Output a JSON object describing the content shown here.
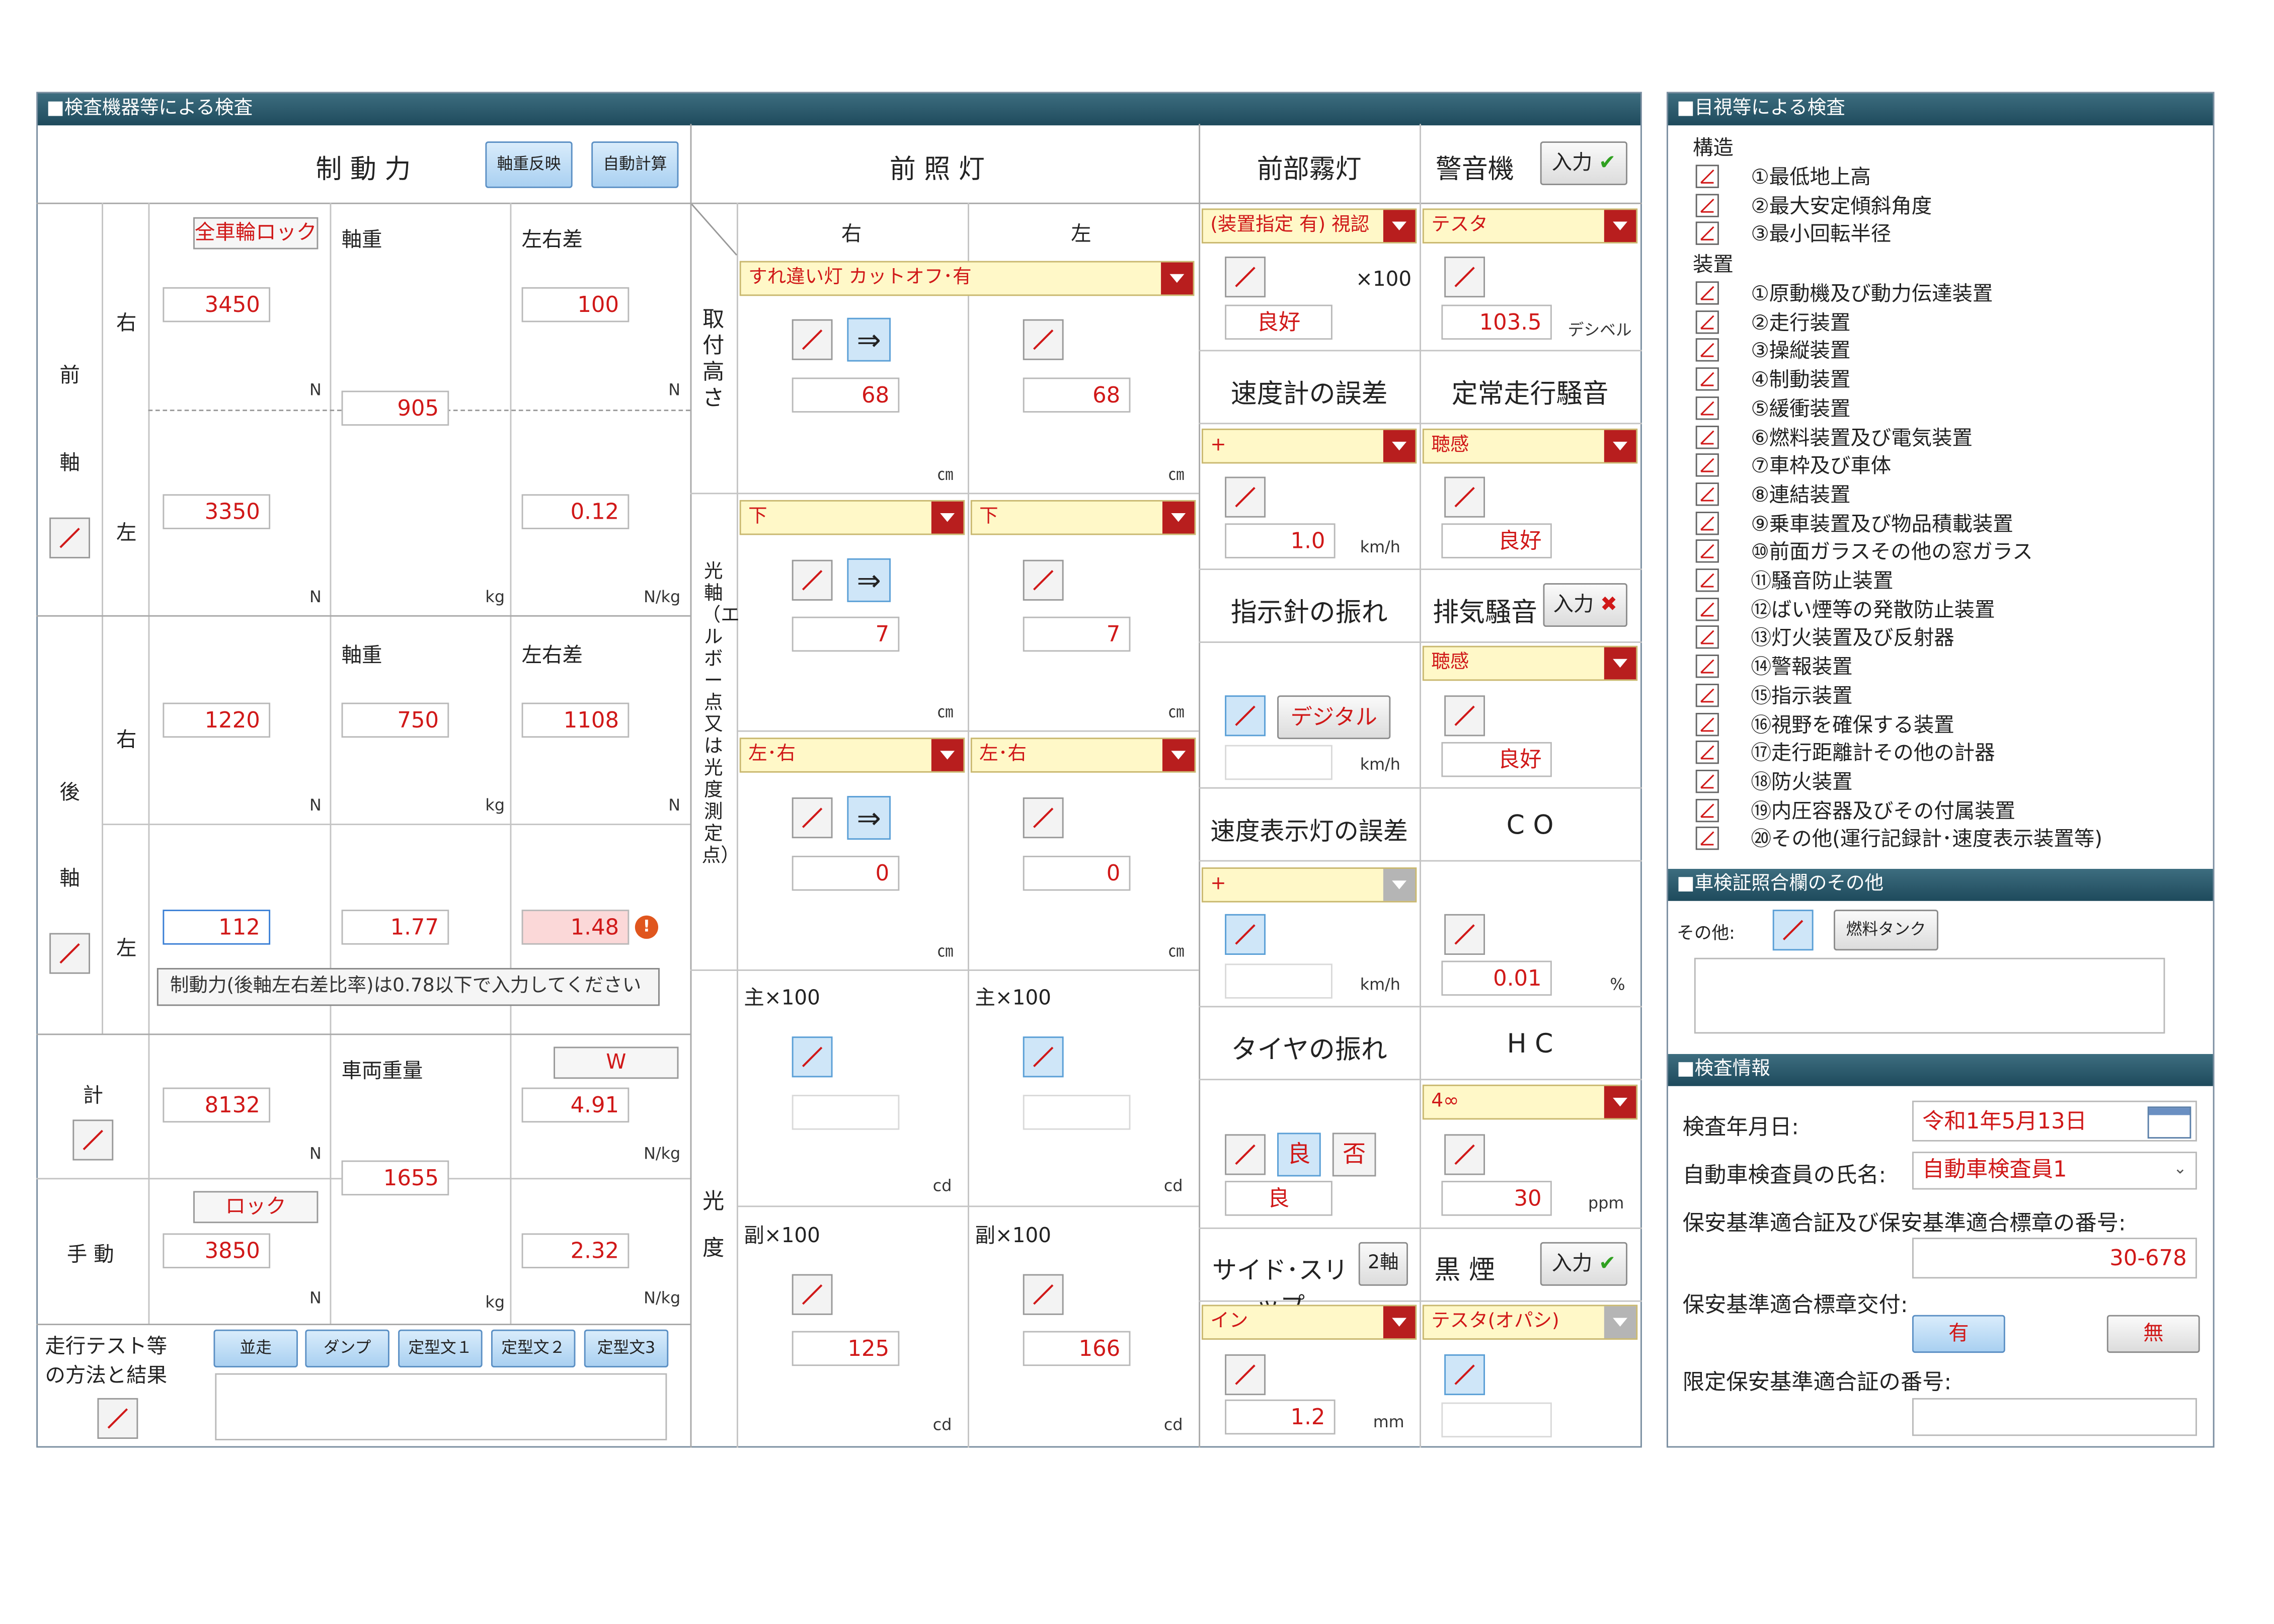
{
  "left_panel": {
    "title": "■検査機器等による検査",
    "brake": {
      "header": "制 動 力",
      "btn_axle_reflect": "軸重反映",
      "btn_auto_calc": "自動計算",
      "all_wheel_lock": "全車輪ロック",
      "col_axle": "軸重",
      "col_diff": "左右差",
      "front": {
        "label_1": "前",
        "label_2": "軸",
        "right_label": "右",
        "left_label": "左",
        "right_value": "3450",
        "diff_value": "100",
        "axle_value": "905",
        "left_value": "3350",
        "diff_ratio": "0.12"
      },
      "rear": {
        "label_1": "後",
        "label_2": "軸",
        "right_label": "右",
        "left_label": "左",
        "axle_header": "軸重",
        "diff_header": "左右差",
        "right_value": "1220",
        "axle_value": "750",
        "diff_value": "1108",
        "left_value": "112",
        "axle2_value": "1.77",
        "diff_ratio": "1.48"
      },
      "tooltip": "制動力(後軸左右差比率)は0.78以下で入力してください",
      "total": {
        "label": "計",
        "value": "8132",
        "weight_label": "車両重量",
        "weight_value": "1655",
        "w_btn": "W",
        "w_value": "4.91"
      },
      "hand": {
        "label": "手 動",
        "lock_btn": "ロック",
        "value": "3850",
        "ratio": "2.32"
      },
      "run_test": {
        "label": "走行テスト等の方法と結果",
        "btns": [
          "並走",
          "ダンプ",
          "定型文１",
          "定型文２",
          "定型文3"
        ]
      },
      "units": {
        "N": "N",
        "kg": "kg",
        "Nkg": "N/kg"
      }
    },
    "headlight": {
      "header": "前 照 灯",
      "col_right": "右",
      "col_left": "左",
      "mount_label": "取付高さ",
      "axis_label": "光軸（エルボー点又は光度測定点）",
      "intensity_label": "光度",
      "dropdown_beam": "すれ違い灯 カットオフ･有",
      "height_right": "68",
      "height_left": "68",
      "dd_down_r": "下",
      "dd_down_l": "下",
      "axis_right": "7",
      "axis_left": "7",
      "dd_lr_r": "左･右",
      "dd_lr_l": "左･右",
      "axis2_right": "0",
      "axis2_left": "0",
      "main_label": "主×100",
      "sub_label": "副×100",
      "sub_right": "125",
      "sub_left": "166",
      "arrow": "⇒",
      "unit_cm": "㎝",
      "unit_cd": "cd"
    },
    "fog": {
      "header": "前部霧灯",
      "dd": "(装置指定 有) 視認",
      "x100": "×100",
      "result": "良好"
    },
    "horn": {
      "header": "警音機",
      "input_btn": "入力",
      "dd": "テスタ",
      "value": "103.5",
      "unit": "デシベル"
    },
    "speedo": {
      "header": "速度計の誤差",
      "dd": "+",
      "value": "1.0",
      "unit": "km/h"
    },
    "steady_noise": {
      "header": "定常走行騒音",
      "dd": "聴感",
      "result": "良好"
    },
    "needle": {
      "header": "指示針の振れ",
      "digital_btn": "デジタル",
      "unit": "km/h"
    },
    "exhaust_noise": {
      "header": "排気騒音",
      "input_btn": "入力",
      "dd": "聴感",
      "result": "良好"
    },
    "speed_display": {
      "header": "速度表示灯の誤差",
      "dd": "+",
      "unit": "km/h"
    },
    "co": {
      "header": "C O",
      "value": "0.01",
      "unit": "%"
    },
    "tire": {
      "header": "タイヤの振れ",
      "good_btn": "良",
      "bad_btn": "否",
      "result": "良"
    },
    "hc": {
      "header": "H C",
      "dd": "4∞",
      "value": "30",
      "unit": "ppm"
    },
    "side_slip": {
      "header": "サイド･スリップ",
      "axle_btn": "2軸",
      "dd": "イン",
      "value": "1.2",
      "unit": "mm"
    },
    "smoke": {
      "header": "黒 煙",
      "input_btn": "入力",
      "dd": "テスタ(オパシ)"
    }
  },
  "right_panel": {
    "visual": {
      "title": "■目視等による検査",
      "structure_label": "構造",
      "structure_items": [
        "①最低地上高",
        "②最大安定傾斜角度",
        "③最小回転半径"
      ],
      "device_label": "装置",
      "device_items": [
        "①原動機及び動力伝達装置",
        "②走行装置",
        "③操縦装置",
        "④制動装置",
        "⑤緩衝装置",
        "⑥燃料装置及び電気装置",
        "⑦車枠及び車体",
        "⑧連結装置",
        "⑨乗車装置及び物品積載装置",
        "⑩前面ガラスその他の窓ガラス",
        "⑪騒音防止装置",
        "⑫ばい煙等の発散防止装置",
        "⑬灯火装置及び反射器",
        "⑭警報装置",
        "⑮指示装置",
        "⑯視野を確保する装置",
        "⑰走行距離計その他の計器",
        "⑱防火装置",
        "⑲内圧容器及びその付属装置",
        "⑳その他(運行記録計･速度表示装置等)"
      ]
    },
    "cert_other": {
      "title": "■車検証照合欄のその他",
      "label": "その他:",
      "fuel_btn": "燃料タンク"
    },
    "inspection_info": {
      "title": "■検査情報",
      "date_label": "検査年月日:",
      "date_value": "令和1年5月13日",
      "inspector_label": "自動車検査員の氏名:",
      "inspector_value": "自動車検査員1",
      "cert_number_label": "保安基準適合証及び保安基準適合標章の番号:",
      "cert_number_value": "30-678",
      "sticker_label": "保安基準適合標章交付:",
      "yes_btn": "有",
      "no_btn": "無",
      "limited_label": "限定保安基準適合証の番号:"
    }
  },
  "colors": {
    "header_bar": "#1e4a5c",
    "value_text": "#d01818",
    "dropdown_bg": "#fff8c8",
    "dropdown_arrow": "#b81e1e"
  }
}
